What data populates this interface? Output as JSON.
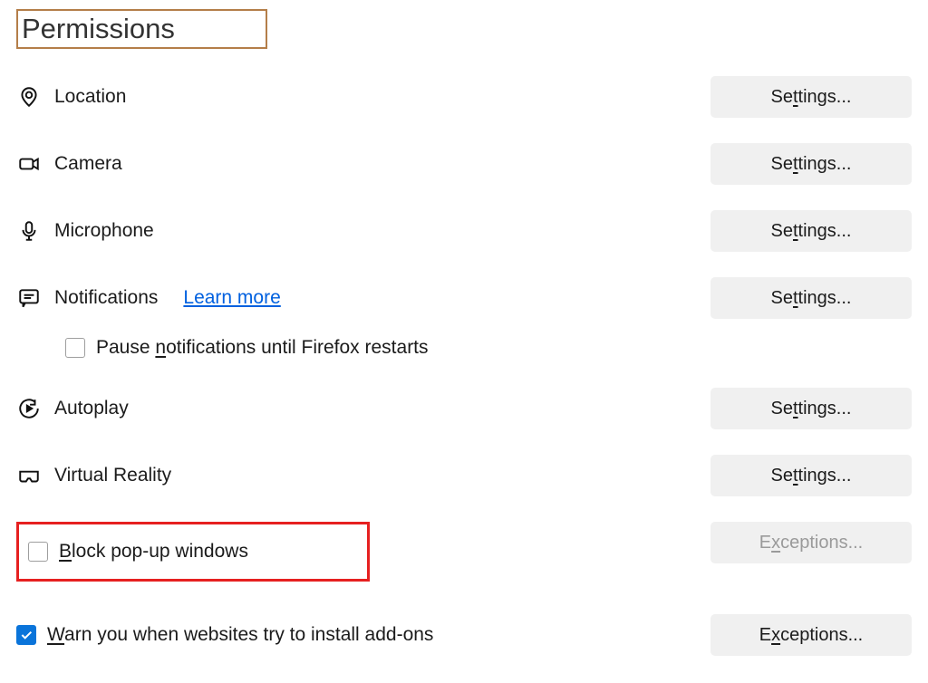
{
  "section": {
    "title": "Permissions"
  },
  "permissions": {
    "location": {
      "label": "Location",
      "button_pre": "Se",
      "button_u": "t",
      "button_post": "tings..."
    },
    "camera": {
      "label": "Camera",
      "button_pre": "Se",
      "button_u": "t",
      "button_post": "tings..."
    },
    "microphone": {
      "label": "Microphone",
      "button_pre": "Se",
      "button_u": "t",
      "button_post": "tings..."
    },
    "notifications": {
      "label": "Notifications",
      "learn_more": "Learn more",
      "button_pre": "Se",
      "button_u": "t",
      "button_post": "tings..."
    },
    "pause_notifications": {
      "label_pre": "Pause ",
      "label_u": "n",
      "label_post": "otifications until Firefox restarts",
      "checked": false
    },
    "autoplay": {
      "label": "Autoplay",
      "button_pre": "Se",
      "button_u": "t",
      "button_post": "tings..."
    },
    "vr": {
      "label": "Virtual Reality",
      "button_pre": "Se",
      "button_u": "t",
      "button_post": "tings..."
    }
  },
  "block_popups": {
    "label_u": "B",
    "label_post": "lock pop-up windows",
    "checked": false,
    "button_pre": "E",
    "button_u": "x",
    "button_post": "ceptions..."
  },
  "warn_addons": {
    "label_u": "W",
    "label_post": "arn you when websites try to install add-ons",
    "checked": true,
    "button_pre": "E",
    "button_u": "x",
    "button_post": "ceptions..."
  }
}
